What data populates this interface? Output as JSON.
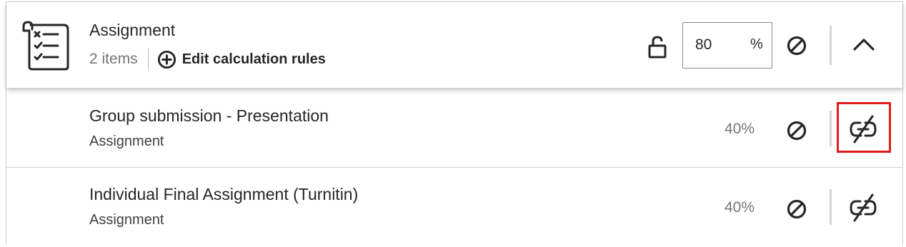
{
  "category": {
    "title": "Assignment",
    "items_count": "2 items",
    "edit_rules_label": "Edit calculation rules",
    "weight_value": "80",
    "weight_unit": "%",
    "icon": "assignment-checklist-icon",
    "lock_icon": "unlocked-padlock-icon",
    "exclude_icon": "prohibited-icon",
    "collapse_icon": "chevron-up-icon"
  },
  "items": [
    {
      "title": "Group submission - Presentation",
      "type": "Assignment",
      "weight": "40%",
      "exclude_icon": "prohibited-icon",
      "unlink_icon": "broken-link-icon"
    },
    {
      "title": "Individual Final Assignment (Turnitin)",
      "type": "Assignment",
      "weight": "40%",
      "exclude_icon": "prohibited-icon",
      "unlink_icon": "broken-link-icon"
    }
  ],
  "colors": {
    "text": "#262626",
    "muted": "#767676",
    "border": "#d2d2d2",
    "highlight": "#e01b1b"
  }
}
